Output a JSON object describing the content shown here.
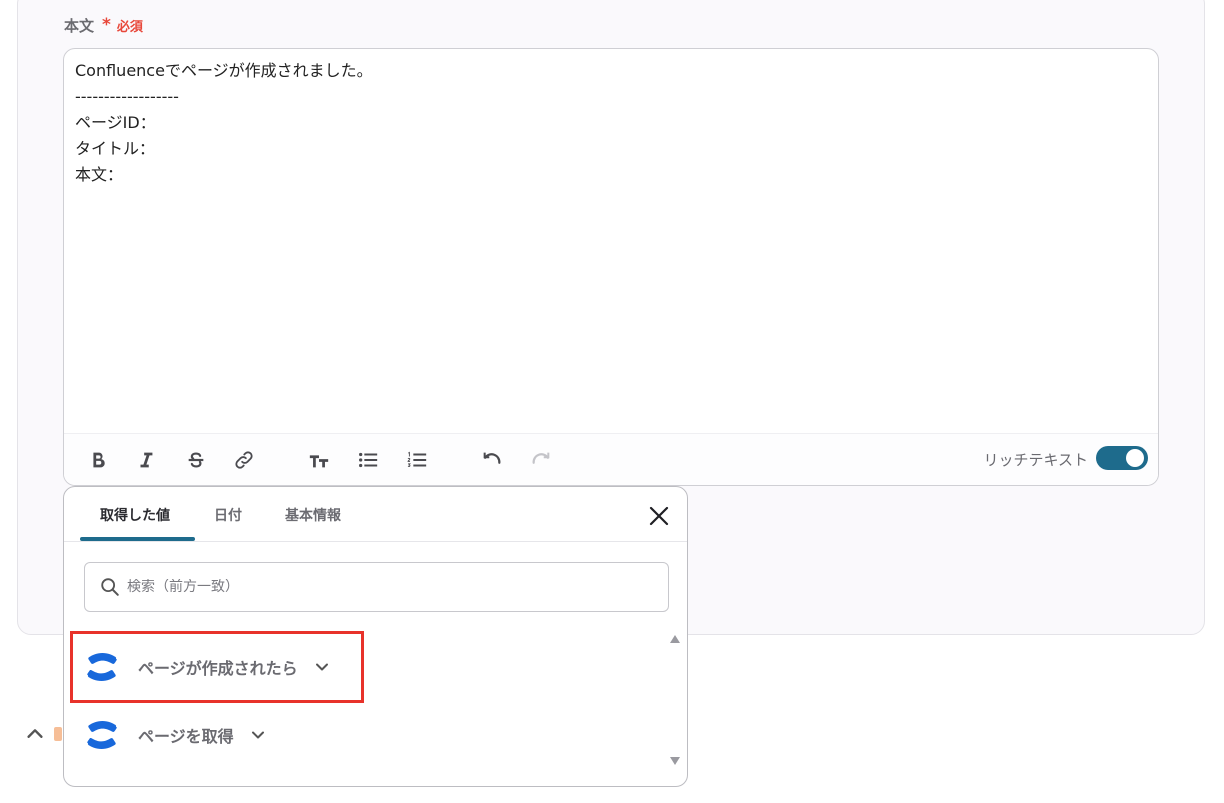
{
  "field": {
    "label": "本文",
    "required_star": "*",
    "required_text": "必須"
  },
  "editor": {
    "lines": [
      "Confluenceでページが作成されました。",
      "------------------",
      "ページID：",
      "タイトル：",
      "本文："
    ],
    "toolbar": {
      "bold_icon": "bold-icon",
      "italic_icon": "italic-icon",
      "strike_icon": "strikethrough-icon",
      "link_icon": "link-icon",
      "textsize_icon": "text-size-icon",
      "bullet_icon": "bullet-list-icon",
      "numbered_icon": "numbered-list-icon",
      "undo_icon": "undo-icon",
      "redo_icon": "redo-icon",
      "rich_text_label": "リッチテキスト",
      "rich_text_enabled": true
    }
  },
  "popup": {
    "tabs": [
      {
        "label": "取得した値",
        "active": true
      },
      {
        "label": "日付",
        "active": false
      },
      {
        "label": "基本情報",
        "active": false
      }
    ],
    "search": {
      "placeholder": "検索（前方一致）",
      "value": ""
    },
    "items": [
      {
        "label": "ページが作成されたら",
        "icon": "confluence-logo-icon",
        "highlighted": true
      },
      {
        "label": "ページを取得",
        "icon": "confluence-logo-icon",
        "highlighted": false
      }
    ]
  },
  "colors": {
    "accent": "#1e6b8c",
    "required": "#e8473a",
    "highlight_box": "#e8322a",
    "confluence_blue": "#1868db"
  }
}
